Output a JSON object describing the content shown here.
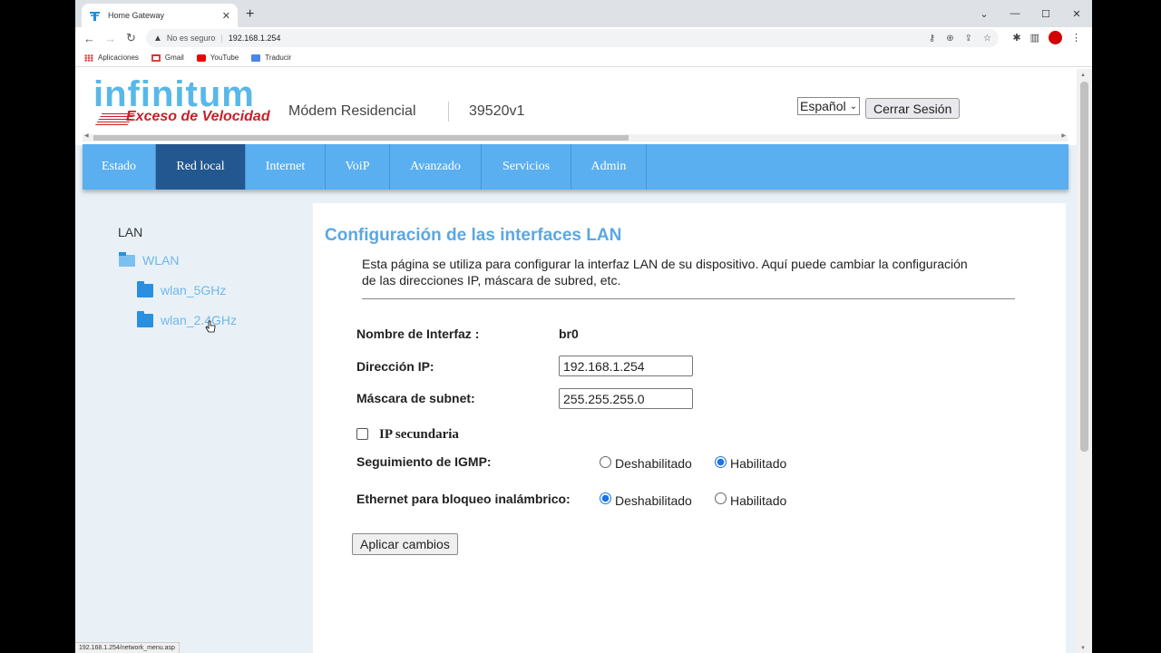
{
  "browser": {
    "tab_title": "Home Gateway",
    "tab_close": "✕",
    "new_tab": "+",
    "window_controls": [
      "⌄",
      "—",
      "☐",
      "✕"
    ],
    "security_label": "No es seguro",
    "url": "192.168.1.254",
    "bookmarks": [
      {
        "label": "Aplicaciones",
        "icon": "apps-grid-icon"
      },
      {
        "label": "Gmail",
        "icon": "gmail-icon"
      },
      {
        "label": "YouTube",
        "icon": "youtube-icon"
      },
      {
        "label": "Traducir",
        "icon": "translate-icon"
      }
    ],
    "status_url": "192.168.1.254/network_menu.asp"
  },
  "header": {
    "logo_text": "infinitum",
    "logo_slogan": "Exceso de Velocidad",
    "model_name": "Módem Residencial",
    "model_number": "39520v1",
    "language": "Español",
    "logout_label": "Cerrar Sesión"
  },
  "nav": {
    "items": [
      {
        "label": "Estado",
        "active": false
      },
      {
        "label": "Red local",
        "active": true
      },
      {
        "label": "Internet",
        "active": false
      },
      {
        "label": "VoiP",
        "active": false
      },
      {
        "label": "Avanzado",
        "active": false
      },
      {
        "label": "Servicios",
        "active": false
      },
      {
        "label": "Admin",
        "active": false
      }
    ]
  },
  "sidebar": {
    "title": "LAN",
    "items": [
      {
        "label": "WLAN",
        "icon": "folder-open-icon"
      },
      {
        "label": "wlan_5GHz",
        "icon": "folder-icon"
      },
      {
        "label": "wlan_2.4GHz",
        "icon": "folder-icon"
      }
    ]
  },
  "main": {
    "title": "Configuración de las interfaces LAN",
    "description": "Esta página se utiliza para configurar la interfaz LAN de su dispositivo. Aquí puede cambiar la configuración de las direcciones IP, máscara de subred, etc.",
    "interface_name_label": "Nombre de Interfaz :",
    "interface_name_value": "br0",
    "ip_label": "Dirección IP:",
    "ip_value": "192.168.1.254",
    "mask_label": "Máscara de subnet:",
    "mask_value": "255.255.255.0",
    "secondary_ip_label": "IP secundaria",
    "secondary_ip_checked": false,
    "igmp_label": "Seguimiento de IGMP:",
    "igmp_options": [
      "Deshabilitado",
      "Habilitado"
    ],
    "igmp_selected": "Habilitado",
    "ethernet_label": "Ethernet para bloqueo inalámbrico:",
    "ethernet_options": [
      "Deshabilitado",
      "Habilitado"
    ],
    "ethernet_selected": "Deshabilitado",
    "apply_label": "Aplicar cambios"
  },
  "colors": {
    "nav_bg": "#5aaff0",
    "nav_active": "#23578f",
    "title_blue": "#5ba7e2",
    "sidebar_link": "#6fb7ea"
  }
}
